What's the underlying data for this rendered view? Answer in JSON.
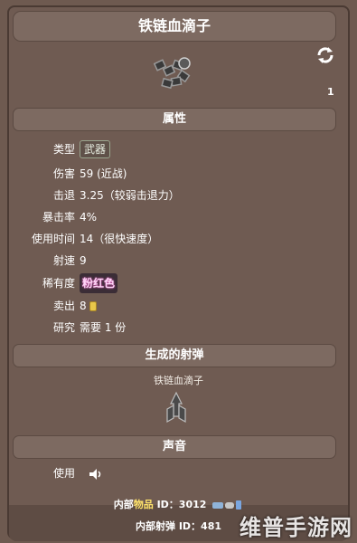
{
  "title": "铁链血滴子",
  "corner_number": "1",
  "sections": {
    "attributes": "属性",
    "projectile": "生成的射弹",
    "sound": "声音"
  },
  "stats": {
    "type_label": "类型",
    "type_value": "武器",
    "damage_label": "伤害",
    "damage_value": "59 (近战)",
    "knockback_label": "击退",
    "knockback_value": "3.25（较弱击退力）",
    "crit_label": "暴击率",
    "crit_value": "4%",
    "usetime_label": "使用时间",
    "usetime_value": "14（很快速度）",
    "shootspeed_label": "射速",
    "shootspeed_value": "9",
    "rarity_label": "稀有度",
    "rarity_value": "粉红色",
    "sell_label": "卖出",
    "sell_value": "8",
    "research_label": "研究",
    "research_value": "需要 1 份"
  },
  "projectile_name": "铁链血滴子",
  "sound": {
    "use_label": "使用"
  },
  "footer": {
    "internal_item_prefix": "内部",
    "internal_item_word": "物品",
    "internal_item_suffix": " ID：3012",
    "internal_proj": "内部射弹 ID：481"
  },
  "watermark": "维普手游网",
  "colors": {
    "background": "#6e5a50",
    "bar": "#7d6a61",
    "rarity_pink": "#ff79d2"
  },
  "icons": [
    "refresh-icon",
    "flail-item-icon",
    "projectile-icon",
    "speaker-icon",
    "coin-icon"
  ]
}
